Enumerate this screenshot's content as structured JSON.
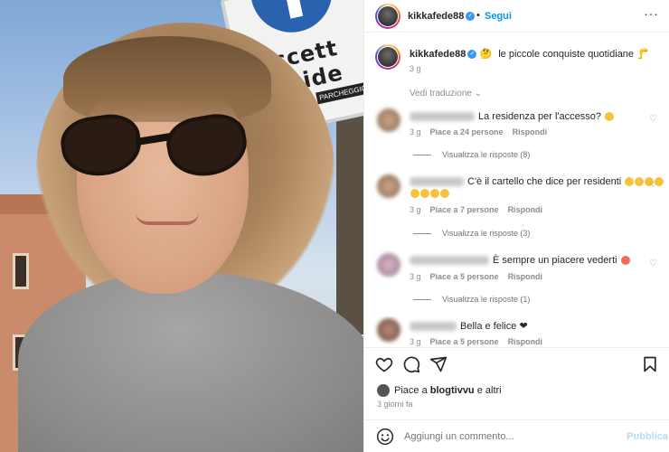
{
  "photo": {
    "sign_text_line1": "eccett",
    "sign_text_line2": "reside",
    "sign_small": "PARCHEGGIO"
  },
  "header": {
    "username": "kikkafede88",
    "verified_badge": "✓",
    "separator": "•",
    "follow_label": "Segui",
    "more_label": "···"
  },
  "caption": {
    "username": "kikkafede88",
    "text": "le piccole conquiste quotidiane",
    "time": "3 g"
  },
  "see_translation": "Vedi traduzione",
  "comments": [
    {
      "text": "La residenza per l'accesso?",
      "time": "3 g",
      "likes": "Piace a 24 persone",
      "reply": "Rispondi",
      "replies_label": "Visualizza le risposte (8)"
    },
    {
      "text": "C'è il cartello che dice per residenti",
      "time": "3 g",
      "likes": "Piace a 7 persone",
      "reply": "Rispondi",
      "replies_label": "Visualizza le risposte (3)"
    },
    {
      "text": "È sempre un piacere vederti",
      "time": "3 g",
      "likes": "Piace a 5 persone",
      "reply": "Rispondi",
      "replies_label": "Visualizza le risposte (1)"
    },
    {
      "text": "Bella e felice",
      "time": "3 g",
      "likes": "Piace a 5 persone",
      "reply": "Rispondi"
    }
  ],
  "actions": {
    "like_icon": "heart-icon",
    "comment_icon": "comment-icon",
    "share_icon": "share-icon",
    "save_icon": "bookmark-icon"
  },
  "likes": {
    "prefix": "Piace a",
    "user": "blogtivvu",
    "suffix": "e altri"
  },
  "posted_ago": "3 giorni fa",
  "add_comment": {
    "placeholder": "Aggiungi un commento...",
    "post_label": "Pubblica"
  },
  "colors": {
    "link_blue": "#0095f6",
    "post_disabled": "#b3dbff",
    "muted": "#8e8e8e"
  }
}
